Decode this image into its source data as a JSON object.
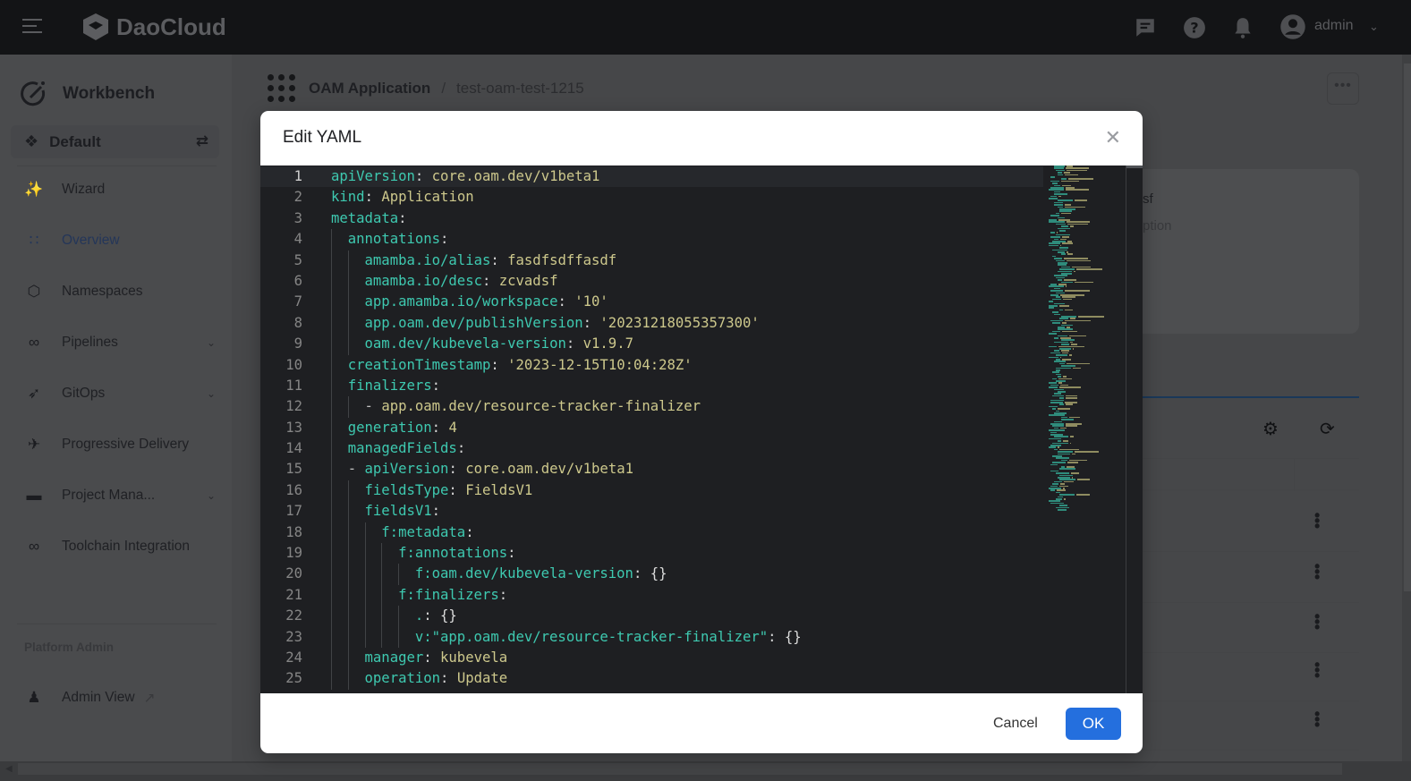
{
  "topbar": {
    "brand": "DaoCloud",
    "user": "admin"
  },
  "sidebar": {
    "workspace_title": "Workbench",
    "workspace_selector": "Default",
    "items": [
      {
        "label": "Wizard",
        "icon": "magic-wand-icon"
      },
      {
        "label": "Overview",
        "icon": "grid-icon",
        "active": true
      },
      {
        "label": "Namespaces",
        "icon": "cube-icon"
      },
      {
        "label": "Pipelines",
        "icon": "pipeline-icon",
        "expandable": true
      },
      {
        "label": "GitOps",
        "icon": "rocket-icon",
        "expandable": true
      },
      {
        "label": "Progressive Delivery",
        "icon": "bird-icon"
      },
      {
        "label": "Project Mana...",
        "icon": "folder-icon",
        "expandable": true
      },
      {
        "label": "Toolchain Integration",
        "icon": "infinity-icon"
      }
    ],
    "section_label": "Platform Admin",
    "admin_view": "Admin View"
  },
  "main": {
    "breadcrumb": {
      "parent": "OAM Application",
      "separator": "/",
      "current": "test-oam-test-1215"
    },
    "card_fragment_1": "sf",
    "card_fragment_2": "ption"
  },
  "modal": {
    "title": "Edit YAML",
    "cancel_label": "Cancel",
    "ok_label": "OK",
    "colors": {
      "key": "#3ec9b0",
      "value": "#cdc88c",
      "ok_button": "#246fde",
      "editor_bg": "#1e1f22"
    },
    "lines": [
      {
        "indent": 0,
        "key": "apiVersion",
        "value": "core.oam.dev/v1beta1"
      },
      {
        "indent": 0,
        "key": "kind",
        "value": "Application"
      },
      {
        "indent": 0,
        "key": "metadata",
        "value": ""
      },
      {
        "indent": 1,
        "key": "annotations",
        "value": ""
      },
      {
        "indent": 2,
        "key": "amamba.io/alias",
        "value": "fasdfsdffasdf"
      },
      {
        "indent": 2,
        "key": "amamba.io/desc",
        "value": "zcvadsf"
      },
      {
        "indent": 2,
        "key": "app.amamba.io/workspace",
        "value": "'10'"
      },
      {
        "indent": 2,
        "key": "app.oam.dev/publishVersion",
        "value": "'20231218055357300'"
      },
      {
        "indent": 2,
        "key": "oam.dev/kubevela-version",
        "value": "v1.9.7"
      },
      {
        "indent": 1,
        "key": "creationTimestamp",
        "value": "'2023-12-15T10:04:28Z'"
      },
      {
        "indent": 1,
        "key": "finalizers",
        "value": ""
      },
      {
        "indent": 2,
        "dash": true,
        "key": "",
        "value": "app.oam.dev/resource-tracker-finalizer"
      },
      {
        "indent": 1,
        "key": "generation",
        "value": "4"
      },
      {
        "indent": 1,
        "key": "managedFields",
        "value": ""
      },
      {
        "indent": 1,
        "dash": true,
        "key": "apiVersion",
        "value": "core.oam.dev/v1beta1"
      },
      {
        "indent": 2,
        "key": "fieldsType",
        "value": "FieldsV1"
      },
      {
        "indent": 2,
        "key": "fieldsV1",
        "value": ""
      },
      {
        "indent": 3,
        "key": "f:metadata",
        "value": ""
      },
      {
        "indent": 4,
        "key": "f:annotations",
        "value": ""
      },
      {
        "indent": 5,
        "key": "f:oam.dev/kubevela-version",
        "value": "{}",
        "brace": true
      },
      {
        "indent": 4,
        "key": "f:finalizers",
        "value": ""
      },
      {
        "indent": 5,
        "key": ".",
        "value": "{}",
        "brace": true
      },
      {
        "indent": 5,
        "key": "v:\"app.oam.dev/resource-tracker-finalizer\"",
        "value": "{}",
        "brace": true
      },
      {
        "indent": 2,
        "key": "manager",
        "value": "kubevela"
      },
      {
        "indent": 2,
        "key": "operation",
        "value": "Update"
      }
    ]
  }
}
